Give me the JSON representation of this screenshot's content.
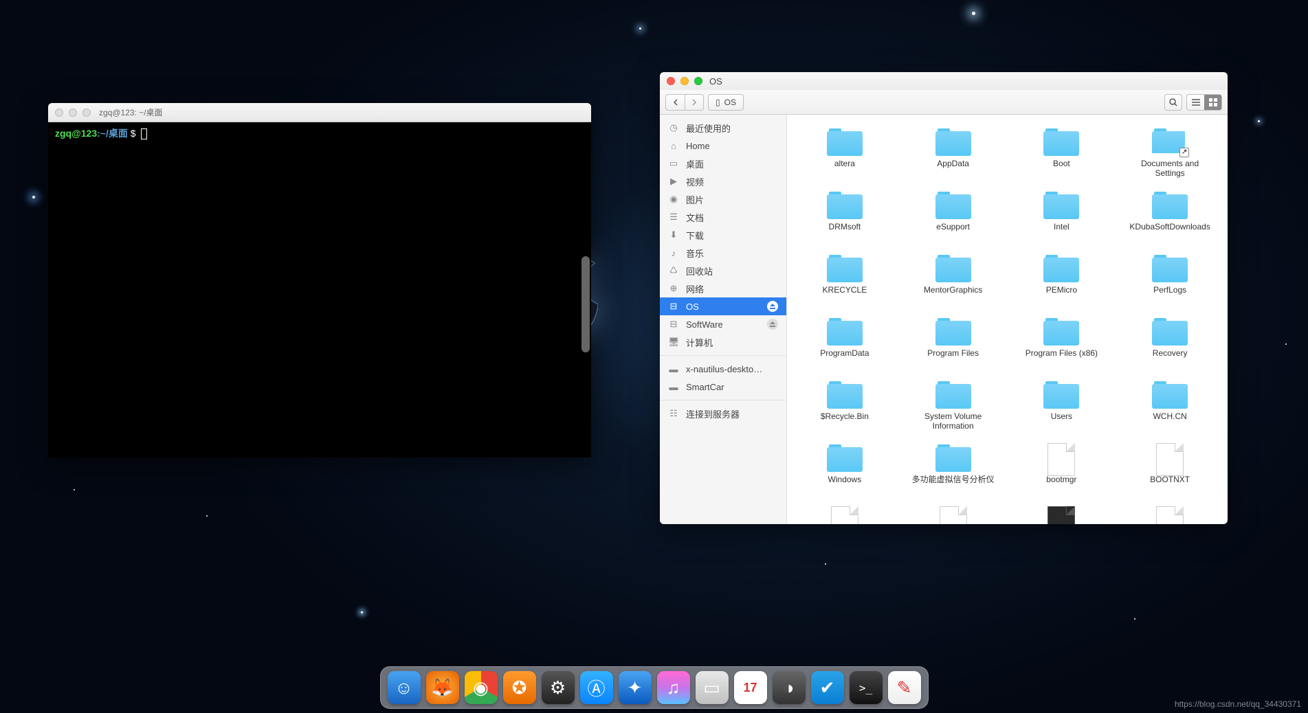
{
  "terminal": {
    "title": "zgq@123: ~/桌面",
    "prompt_user": "zgq@123",
    "prompt_sep": ":",
    "prompt_path": "~/桌面",
    "prompt_symbol": " $"
  },
  "file_manager": {
    "window_title": "OS",
    "path_label": "OS",
    "sidebar": [
      {
        "icon": "clock",
        "label": "最近使用的"
      },
      {
        "icon": "home",
        "label": "Home"
      },
      {
        "icon": "desktop",
        "label": "桌面"
      },
      {
        "icon": "video",
        "label": "视频"
      },
      {
        "icon": "image",
        "label": "图片"
      },
      {
        "icon": "doc",
        "label": "文档"
      },
      {
        "icon": "download",
        "label": "下载"
      },
      {
        "icon": "music",
        "label": "音乐"
      },
      {
        "icon": "trash",
        "label": "回收站"
      },
      {
        "icon": "network",
        "label": "网络"
      },
      {
        "icon": "disk",
        "label": "OS",
        "selected": true,
        "eject": true
      },
      {
        "icon": "disk",
        "label": "SoftWare",
        "eject": true
      },
      {
        "icon": "computer",
        "label": "计算机"
      },
      {
        "sep": true
      },
      {
        "icon": "folder",
        "label": "x-nautilus-deskto…"
      },
      {
        "icon": "folder",
        "label": "SmartCar"
      },
      {
        "sep": true
      },
      {
        "icon": "server",
        "label": "连接到服务器"
      }
    ],
    "items": [
      {
        "type": "folder",
        "label": "altera"
      },
      {
        "type": "folder",
        "label": "AppData"
      },
      {
        "type": "folder",
        "label": "Boot"
      },
      {
        "type": "folder",
        "label": "Documents and Settings",
        "shortcut": true
      },
      {
        "type": "folder",
        "label": "DRMsoft"
      },
      {
        "type": "folder",
        "label": "eSupport"
      },
      {
        "type": "folder",
        "label": "Intel"
      },
      {
        "type": "folder",
        "label": "KDubaSoftDownloads"
      },
      {
        "type": "folder",
        "label": "KRECYCLE"
      },
      {
        "type": "folder",
        "label": "MentorGraphics"
      },
      {
        "type": "folder",
        "label": "PEMicro"
      },
      {
        "type": "folder",
        "label": "PerfLogs"
      },
      {
        "type": "folder",
        "label": "ProgramData"
      },
      {
        "type": "folder",
        "label": "Program Files"
      },
      {
        "type": "folder",
        "label": "Program Files (x86)"
      },
      {
        "type": "folder",
        "label": "Recovery"
      },
      {
        "type": "folder",
        "label": "$Recycle.Bin"
      },
      {
        "type": "folder",
        "label": "System Volume Information"
      },
      {
        "type": "folder",
        "label": "Users"
      },
      {
        "type": "folder",
        "label": "WCH.CN"
      },
      {
        "type": "folder",
        "label": "Windows"
      },
      {
        "type": "folder",
        "label": "多功能虚拟信号分析仪"
      },
      {
        "type": "file",
        "label": "bootmgr"
      },
      {
        "type": "file",
        "label": "BOOTNXT"
      },
      {
        "type": "file",
        "label": ""
      },
      {
        "type": "file",
        "label": ""
      },
      {
        "type": "file",
        "label": "",
        "dark": true
      },
      {
        "type": "file",
        "label": ""
      }
    ]
  },
  "dock": [
    {
      "name": "finder",
      "bg": "linear-gradient(#4aa3f2,#1765c2)",
      "glyph": "☺"
    },
    {
      "name": "firefox",
      "bg": "radial-gradient(circle,#ffb13d,#e66000)",
      "glyph": "🦊"
    },
    {
      "name": "chrome",
      "bg": "conic-gradient(#ea4335 0 120deg,#34a853 120deg 240deg,#fbbc05 240deg 360deg)",
      "glyph": "◉"
    },
    {
      "name": "foxit",
      "bg": "linear-gradient(#ff9a2e,#e66b00)",
      "glyph": "✪"
    },
    {
      "name": "settings",
      "bg": "linear-gradient(#555,#222)",
      "glyph": "⚙"
    },
    {
      "name": "appstore",
      "bg": "linear-gradient(#33b1ff,#0a84ff)",
      "glyph": "Ⓐ"
    },
    {
      "name": "safari",
      "bg": "linear-gradient(#4aa3f2,#0a5bbf)",
      "glyph": "✦"
    },
    {
      "name": "itunes",
      "bg": "linear-gradient(#ff6ad5,#c774e8,#5bc0ff)",
      "glyph": "♫"
    },
    {
      "name": "facetime",
      "bg": "linear-gradient(#e8e8e8,#c0c0c0)",
      "glyph": "▭"
    },
    {
      "name": "calendar",
      "bg": "#fff",
      "glyph": "17"
    },
    {
      "name": "quicktime",
      "bg": "linear-gradient(#666,#333)",
      "glyph": "◑"
    },
    {
      "name": "utility",
      "bg": "linear-gradient(#2aa3e8,#0a7fd4)",
      "glyph": "✔"
    },
    {
      "name": "terminal",
      "bg": "linear-gradient(#444,#111)",
      "glyph": ">_"
    },
    {
      "name": "notes",
      "bg": "linear-gradient(#fff,#eee)",
      "glyph": "✎"
    }
  ],
  "watermark": "https://blog.csdn.net/qq_34430371"
}
